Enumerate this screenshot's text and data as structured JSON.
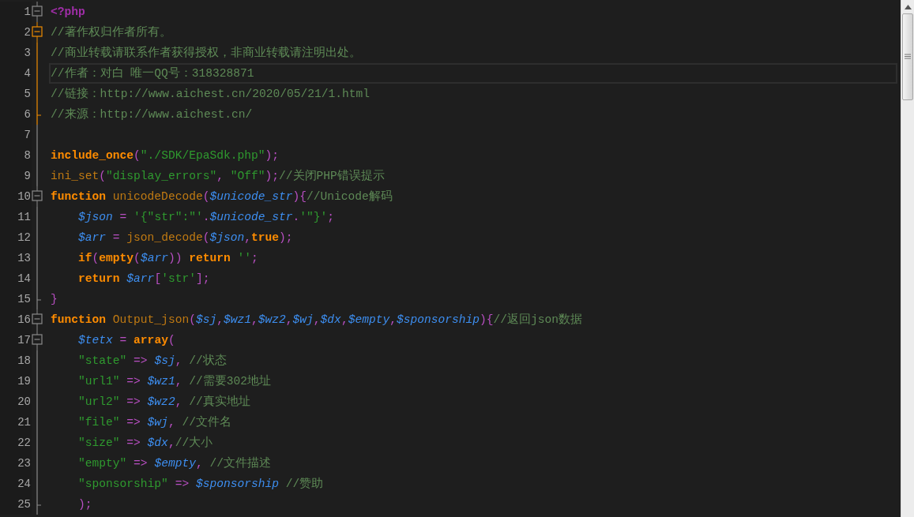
{
  "editor": {
    "lines": [
      {
        "number": "1",
        "kind": "fold_start",
        "active": false,
        "current": false,
        "tokens": [
          {
            "kind": "tag",
            "text": "<?php"
          }
        ]
      },
      {
        "number": "2",
        "kind": "fold_start",
        "active": true,
        "current": false,
        "tokens": [
          {
            "kind": "comment",
            "text": "//著作权归作者所有。"
          }
        ]
      },
      {
        "number": "3",
        "kind": "fold_body",
        "active": true,
        "current": false,
        "tokens": [
          {
            "kind": "comment",
            "text": "//商业转载请联系作者获得授权，非商业转载请注明出处。"
          }
        ]
      },
      {
        "number": "4",
        "kind": "fold_body",
        "active": true,
        "current": true,
        "tokens": [
          {
            "kind": "comment",
            "text": "//作者：对白 唯一QQ号：318328871"
          }
        ]
      },
      {
        "number": "5",
        "kind": "fold_body",
        "active": true,
        "current": false,
        "tokens": [
          {
            "kind": "comment",
            "text": "//链接：http://www.aichest.cn/2020/05/21/1.html"
          }
        ]
      },
      {
        "number": "6",
        "kind": "fold_end",
        "active": true,
        "current": false,
        "tokens": [
          {
            "kind": "comment",
            "text": "//来源：http://www.aichest.cn/"
          }
        ]
      },
      {
        "number": "7",
        "kind": "fold_body",
        "active": false,
        "current": false
      },
      {
        "number": "8",
        "kind": "fold_body",
        "active": false,
        "current": false,
        "tokens": [
          {
            "kind": "keyword",
            "text": "include_once"
          },
          {
            "kind": "op",
            "text": "("
          },
          {
            "kind": "string",
            "text": "\"./SDK/EpaSdk.php\""
          },
          {
            "kind": "op",
            "text": ");"
          }
        ]
      },
      {
        "number": "9",
        "kind": "fold_body",
        "active": false,
        "current": false,
        "tokens": [
          {
            "kind": "function",
            "text": "ini_set"
          },
          {
            "kind": "op",
            "text": "("
          },
          {
            "kind": "string",
            "text": "\"display_errors\""
          },
          {
            "kind": "op",
            "text": ","
          },
          {
            "kind": "string",
            "text": " \"Off\""
          },
          {
            "kind": "op",
            "text": ");"
          },
          {
            "kind": "comment",
            "text": "//关闭PHP错误提示"
          }
        ]
      },
      {
        "number": "10",
        "kind": "fold_start",
        "active": false,
        "current": false,
        "tokens": [
          {
            "kind": "keyword",
            "text": "function"
          },
          {
            "kind": "function",
            "text": " unicodeDecode"
          },
          {
            "kind": "op",
            "text": "("
          },
          {
            "kind": "variable",
            "text": "$unicode_str"
          },
          {
            "kind": "op",
            "text": "){"
          },
          {
            "kind": "comment",
            "text": "//Unicode解码"
          }
        ]
      },
      {
        "number": "11",
        "kind": "fold_body",
        "active": false,
        "current": false,
        "tokens": [
          {
            "kind": "variable",
            "text": "    $json"
          },
          {
            "kind": "op",
            "text": " = "
          },
          {
            "kind": "string",
            "text": "'{\"str\":\"'"
          },
          {
            "kind": "op",
            "text": "."
          },
          {
            "kind": "variable",
            "text": "$unicode_str"
          },
          {
            "kind": "op",
            "text": "."
          },
          {
            "kind": "string",
            "text": "'\"}'"
          },
          {
            "kind": "op",
            "text": ";"
          }
        ]
      },
      {
        "number": "12",
        "kind": "fold_body",
        "active": false,
        "current": false,
        "tokens": [
          {
            "kind": "variable",
            "text": "    $arr"
          },
          {
            "kind": "op",
            "text": " = "
          },
          {
            "kind": "function",
            "text": "json_decode"
          },
          {
            "kind": "op",
            "text": "("
          },
          {
            "kind": "variable",
            "text": "$json"
          },
          {
            "kind": "op",
            "text": ","
          },
          {
            "kind": "keyword",
            "text": "true"
          },
          {
            "kind": "op",
            "text": ");"
          }
        ]
      },
      {
        "number": "13",
        "kind": "fold_body",
        "active": false,
        "current": false,
        "tokens": [
          {
            "kind": "keyword",
            "text": "    if"
          },
          {
            "kind": "op",
            "text": "("
          },
          {
            "kind": "keyword",
            "text": "empty"
          },
          {
            "kind": "op",
            "text": "("
          },
          {
            "kind": "variable",
            "text": "$arr"
          },
          {
            "kind": "op",
            "text": ")) "
          },
          {
            "kind": "keyword",
            "text": "return"
          },
          {
            "kind": "string",
            "text": " ''"
          },
          {
            "kind": "op",
            "text": ";"
          }
        ]
      },
      {
        "number": "14",
        "kind": "fold_body",
        "active": false,
        "current": false,
        "tokens": [
          {
            "kind": "keyword",
            "text": "    return"
          },
          {
            "kind": "variable",
            "text": " $arr"
          },
          {
            "kind": "op",
            "text": "["
          },
          {
            "kind": "string",
            "text": "'str'"
          },
          {
            "kind": "op",
            "text": "];"
          }
        ]
      },
      {
        "number": "15",
        "kind": "fold_end",
        "active": false,
        "current": false,
        "tokens": [
          {
            "kind": "op",
            "text": "}"
          }
        ]
      },
      {
        "number": "16",
        "kind": "fold_start",
        "active": false,
        "current": false,
        "tokens": [
          {
            "kind": "keyword",
            "text": "function"
          },
          {
            "kind": "function",
            "text": " Output_json"
          },
          {
            "kind": "op",
            "text": "("
          },
          {
            "kind": "variable",
            "text": "$sj"
          },
          {
            "kind": "op",
            "text": ","
          },
          {
            "kind": "variable",
            "text": "$wz1"
          },
          {
            "kind": "op",
            "text": ","
          },
          {
            "kind": "variable",
            "text": "$wz2"
          },
          {
            "kind": "op",
            "text": ","
          },
          {
            "kind": "variable",
            "text": "$wj"
          },
          {
            "kind": "op",
            "text": ","
          },
          {
            "kind": "variable",
            "text": "$dx"
          },
          {
            "kind": "op",
            "text": ","
          },
          {
            "kind": "variable",
            "text": "$empty"
          },
          {
            "kind": "op",
            "text": ","
          },
          {
            "kind": "variable",
            "text": "$sponsorship"
          },
          {
            "kind": "op",
            "text": "){"
          },
          {
            "kind": "comment",
            "text": "//返回json数据"
          }
        ]
      },
      {
        "number": "17",
        "kind": "fold_start",
        "active": false,
        "current": false,
        "tokens": [
          {
            "kind": "variable",
            "text": "    $tetx"
          },
          {
            "kind": "op",
            "text": " = "
          },
          {
            "kind": "keyword",
            "text": "array"
          },
          {
            "kind": "op",
            "text": "("
          }
        ]
      },
      {
        "number": "18",
        "kind": "fold_body",
        "active": false,
        "current": false,
        "tokens": [
          {
            "kind": "string",
            "text": "    \"state\""
          },
          {
            "kind": "op",
            "text": " => "
          },
          {
            "kind": "variable",
            "text": "$sj"
          },
          {
            "kind": "op",
            "text": ", "
          },
          {
            "kind": "comment",
            "text": "//状态"
          }
        ]
      },
      {
        "number": "19",
        "kind": "fold_body",
        "active": false,
        "current": false,
        "tokens": [
          {
            "kind": "string",
            "text": "    \"url1\""
          },
          {
            "kind": "op",
            "text": " => "
          },
          {
            "kind": "variable",
            "text": "$wz1"
          },
          {
            "kind": "op",
            "text": ", "
          },
          {
            "kind": "comment",
            "text": "//需要302地址"
          }
        ]
      },
      {
        "number": "20",
        "kind": "fold_body",
        "active": false,
        "current": false,
        "tokens": [
          {
            "kind": "string",
            "text": "    \"url2\""
          },
          {
            "kind": "op",
            "text": " => "
          },
          {
            "kind": "variable",
            "text": "$wz2"
          },
          {
            "kind": "op",
            "text": ", "
          },
          {
            "kind": "comment",
            "text": "//真实地址"
          }
        ]
      },
      {
        "number": "21",
        "kind": "fold_body",
        "active": false,
        "current": false,
        "tokens": [
          {
            "kind": "string",
            "text": "    \"file\""
          },
          {
            "kind": "op",
            "text": " => "
          },
          {
            "kind": "variable",
            "text": "$wj"
          },
          {
            "kind": "op",
            "text": ", "
          },
          {
            "kind": "comment",
            "text": "//文件名"
          }
        ]
      },
      {
        "number": "22",
        "kind": "fold_body",
        "active": false,
        "current": false,
        "tokens": [
          {
            "kind": "string",
            "text": "    \"size\""
          },
          {
            "kind": "op",
            "text": " => "
          },
          {
            "kind": "variable",
            "text": "$dx"
          },
          {
            "kind": "op",
            "text": ","
          },
          {
            "kind": "comment",
            "text": "//大小"
          }
        ]
      },
      {
        "number": "23",
        "kind": "fold_body",
        "active": false,
        "current": false,
        "tokens": [
          {
            "kind": "string",
            "text": "    \"empty\""
          },
          {
            "kind": "op",
            "text": " => "
          },
          {
            "kind": "variable",
            "text": "$empty"
          },
          {
            "kind": "op",
            "text": ", "
          },
          {
            "kind": "comment",
            "text": "//文件描述"
          }
        ]
      },
      {
        "number": "24",
        "kind": "fold_body",
        "active": false,
        "current": false,
        "tokens": [
          {
            "kind": "string",
            "text": "    \"sponsorship\""
          },
          {
            "kind": "op",
            "text": " => "
          },
          {
            "kind": "variable",
            "text": "$sponsorship"
          },
          {
            "kind": "comment",
            "text": " //赞助"
          }
        ]
      },
      {
        "number": "25",
        "kind": "fold_end",
        "active": false,
        "current": false,
        "tokens": [
          {
            "kind": "op",
            "text": "    );"
          }
        ]
      }
    ]
  }
}
